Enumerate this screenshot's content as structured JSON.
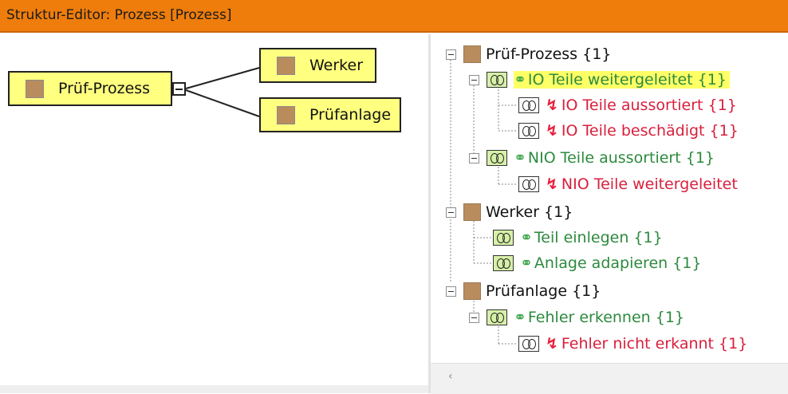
{
  "window": {
    "title": "Struktur-Editor: Prozess [Prozess]"
  },
  "diagram": {
    "root": {
      "label": "Prüf-Prozess"
    },
    "children": [
      {
        "label": "Werker"
      },
      {
        "label": "Prüfanlage"
      }
    ]
  },
  "tree": {
    "items": [
      {
        "kind": "object",
        "label": "Prüf-Prozess {1}",
        "color": "#111111"
      },
      {
        "kind": "function",
        "icon": "link-icon",
        "label": "IO Teile weitergeleitet  {1}",
        "color": "#2d8a3e",
        "highlighted": true
      },
      {
        "kind": "malfunction",
        "icon": "lightning-icon",
        "label": "IO Teile aussortiert {1}",
        "color": "#d81f3c"
      },
      {
        "kind": "malfunction",
        "icon": "lightning-icon",
        "label": "IO Teile beschädigt {1}",
        "color": "#d81f3c"
      },
      {
        "kind": "function",
        "icon": "link-icon",
        "label": "NIO Teile aussortiert  {1}",
        "color": "#2d8a3e"
      },
      {
        "kind": "malfunction",
        "icon": "lightning-icon",
        "label": "NIO Teile weitergeleitet",
        "color": "#d81f3c"
      },
      {
        "kind": "object",
        "label": "Werker {1}",
        "color": "#111111"
      },
      {
        "kind": "function",
        "icon": "link-icon",
        "label": "Teil einlegen {1}",
        "color": "#2d8a3e"
      },
      {
        "kind": "function",
        "icon": "link-icon",
        "label": "Anlage adapieren {1}",
        "color": "#2d8a3e"
      },
      {
        "kind": "object",
        "label": "Prüfanlage {1}",
        "color": "#111111"
      },
      {
        "kind": "function",
        "icon": "link-icon",
        "label": "Fehler erkennen  {1}",
        "color": "#2d8a3e"
      },
      {
        "kind": "malfunction",
        "icon": "lightning-icon",
        "label": "Fehler nicht erkannt {1}",
        "color": "#d81f3c"
      }
    ]
  },
  "scrollbar": {
    "left_arrow": "‹"
  },
  "colors": {
    "titlebar": "#ee7d0c",
    "node_fill": "#ffff80",
    "object_square": "#b98c5e",
    "highlight": "#ffff66"
  }
}
